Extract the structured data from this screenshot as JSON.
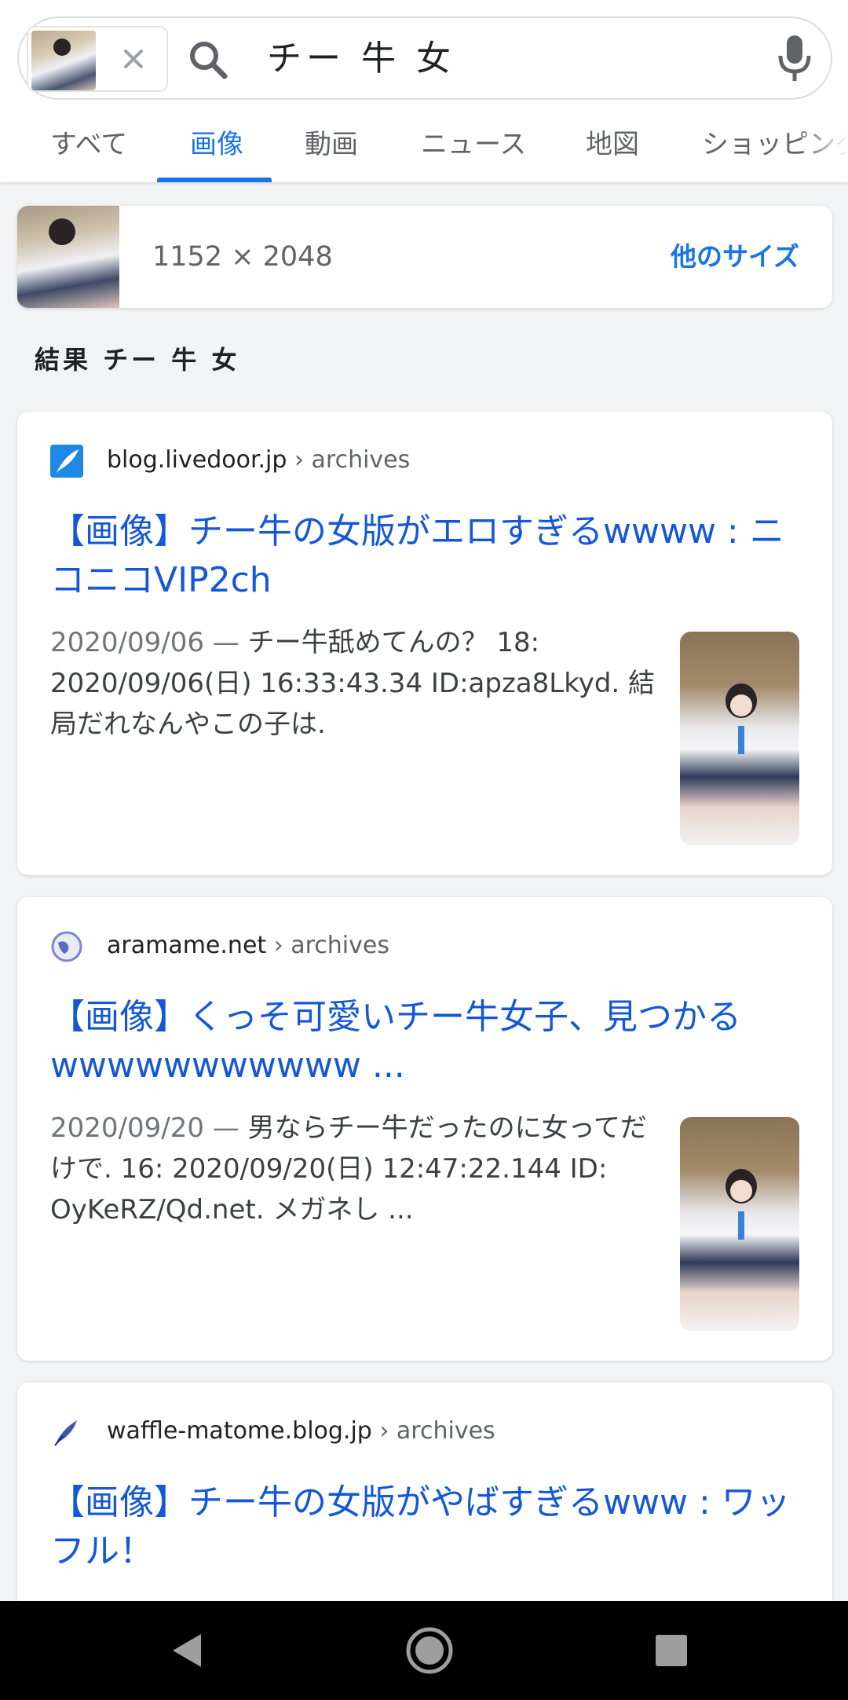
{
  "search": {
    "query": "チー 牛 女"
  },
  "tabs": [
    {
      "label": "すべて",
      "active": false
    },
    {
      "label": "画像",
      "active": true
    },
    {
      "label": "動画",
      "active": false
    },
    {
      "label": "ニュース",
      "active": false
    },
    {
      "label": "地図",
      "active": false
    },
    {
      "label": "ショッピング",
      "active": false
    }
  ],
  "size_card": {
    "dimensions": "1152 × 2048",
    "other_sizes": "他のサイズ"
  },
  "results_heading": "結果 チー 牛 女",
  "results": [
    {
      "domain": "blog.livedoor.jp",
      "path": " › archives",
      "favicon": "feather-icon",
      "title": "【画像】チー牛の女版がエロすぎるwwww : ニコニコVIP2ch",
      "date": "2020/09/06 — ",
      "snippet": "チー牛舐めてんの？ 18: 2020/09/06(日) 16:33:43.34 ID:apza8Lkyd. 結局だれなんやこの子は."
    },
    {
      "domain": "aramame.net",
      "path": " › archives",
      "favicon": "globe-icon",
      "title": "【画像】くっそ可愛いチー牛女子、見つかるwwwwwwwwwww ...",
      "date": "2020/09/20 — ",
      "snippet": "男ならチー牛だったのに女ってだけで. 16: 2020/09/20(日) 12:47:22.144 ID: OyKeRZ/Qd.net. メガネし ..."
    },
    {
      "domain": "waffle-matome.blog.jp",
      "path": " › archives",
      "favicon": "quill-icon",
      "title": "【画像】チー牛の女版がやばすぎるwww : ワッフル！"
    }
  ],
  "colors": {
    "accent": "#1a73e8",
    "link": "#1558d6",
    "background": "#f1f3f4"
  }
}
